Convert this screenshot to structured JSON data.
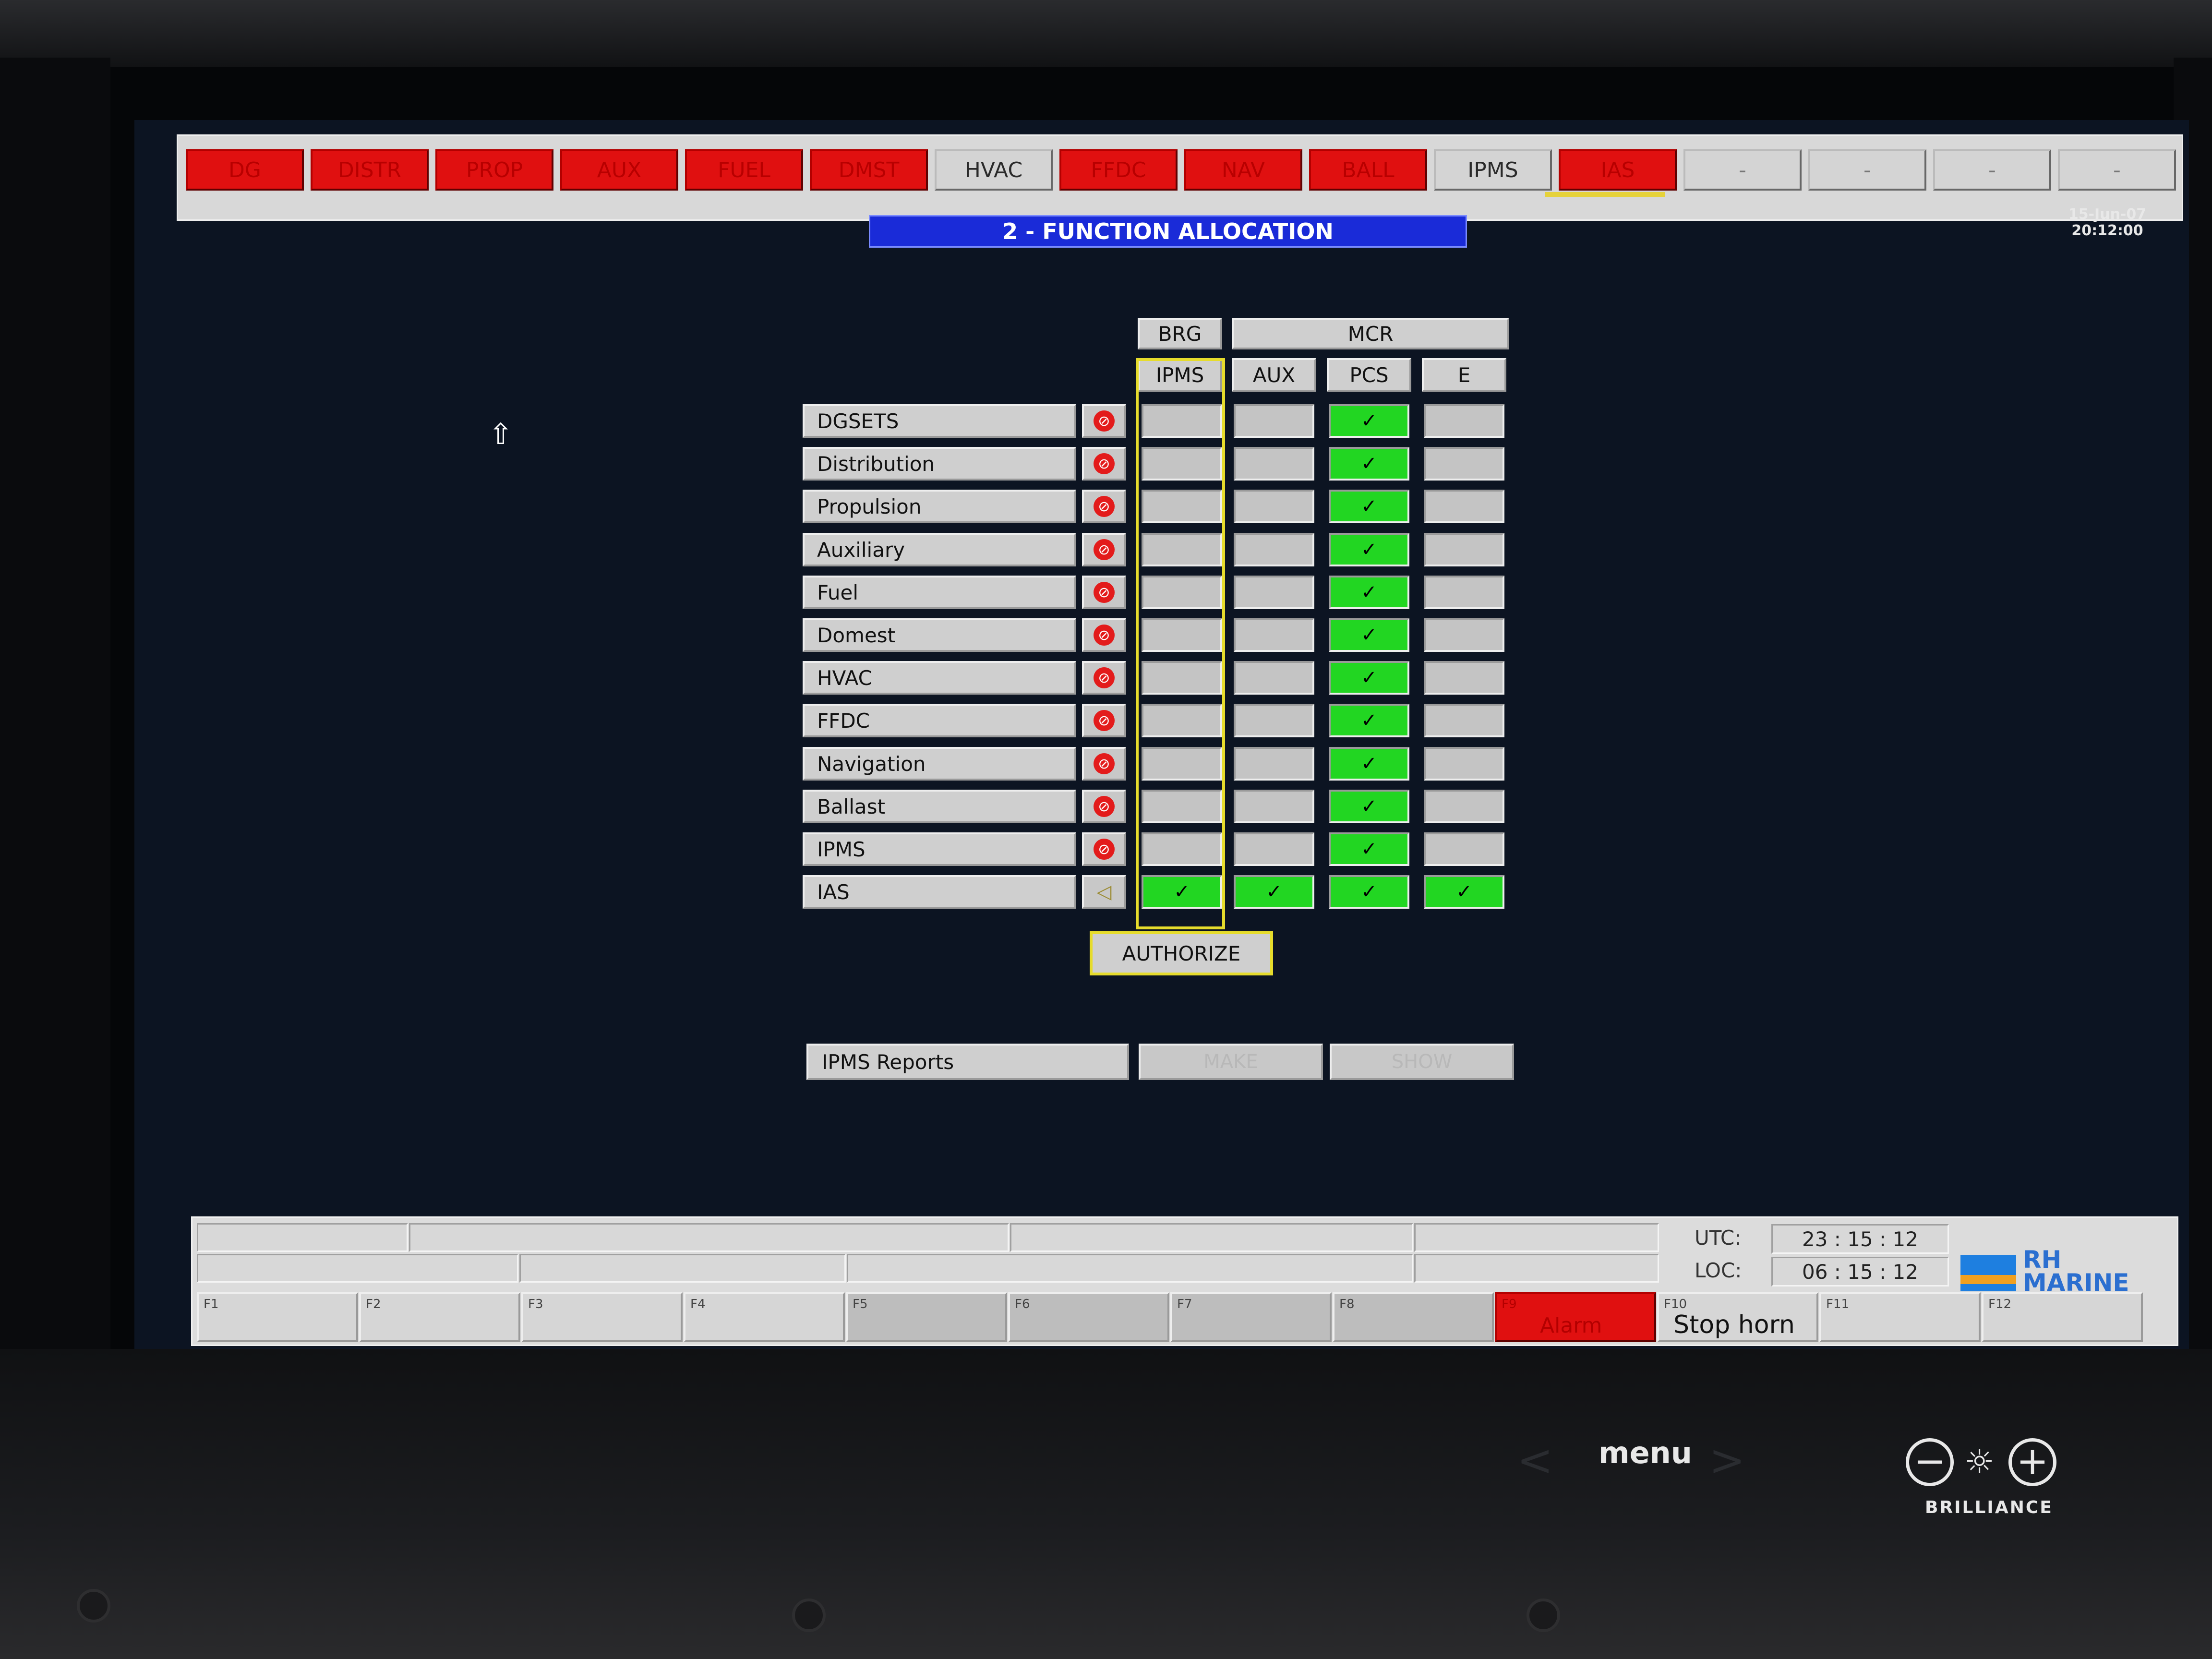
{
  "top_tabs": [
    {
      "label": "DG",
      "state": "alarm"
    },
    {
      "label": "DISTR",
      "state": "alarm"
    },
    {
      "label": "PROP",
      "state": "alarm"
    },
    {
      "label": "AUX",
      "state": "alarm"
    },
    {
      "label": "FUEL",
      "state": "alarm"
    },
    {
      "label": "DMST",
      "state": "alarm"
    },
    {
      "label": "HVAC",
      "state": "normal"
    },
    {
      "label": "FFDC",
      "state": "alarm"
    },
    {
      "label": "NAV",
      "state": "alarm"
    },
    {
      "label": "BALL",
      "state": "alarm"
    },
    {
      "label": "IPMS",
      "state": "normal"
    },
    {
      "label": "IAS",
      "state": "alarm"
    },
    {
      "label": "-",
      "state": "empty"
    },
    {
      "label": "-",
      "state": "empty"
    },
    {
      "label": "-",
      "state": "empty"
    },
    {
      "label": "-",
      "state": "empty"
    }
  ],
  "title": "2 - FUNCTION ALLOCATION",
  "date": "15-Jun-07",
  "time": "20:12:00",
  "headers": {
    "brg": "BRG",
    "mcr": "MCR",
    "columns": [
      "IPMS",
      "AUX",
      "PCS",
      "E"
    ]
  },
  "rows": [
    {
      "label": "DGSETS",
      "alarm": true,
      "cells": [
        false,
        false,
        true,
        false
      ]
    },
    {
      "label": "Distribution",
      "alarm": true,
      "cells": [
        false,
        false,
        true,
        false
      ]
    },
    {
      "label": "Propulsion",
      "alarm": true,
      "cells": [
        false,
        false,
        true,
        false
      ]
    },
    {
      "label": "Auxiliary",
      "alarm": true,
      "cells": [
        false,
        false,
        true,
        false
      ]
    },
    {
      "label": "Fuel",
      "alarm": true,
      "cells": [
        false,
        false,
        true,
        false
      ]
    },
    {
      "label": "Domest",
      "alarm": true,
      "cells": [
        false,
        false,
        true,
        false
      ]
    },
    {
      "label": "HVAC",
      "alarm": true,
      "cells": [
        false,
        false,
        true,
        false
      ]
    },
    {
      "label": "FFDC",
      "alarm": true,
      "cells": [
        false,
        false,
        true,
        false
      ]
    },
    {
      "label": "Navigation",
      "alarm": true,
      "cells": [
        false,
        false,
        true,
        false
      ]
    },
    {
      "label": "Ballast",
      "alarm": true,
      "cells": [
        false,
        false,
        true,
        false
      ]
    },
    {
      "label": "IPMS",
      "alarm": true,
      "cells": [
        false,
        false,
        true,
        false
      ]
    },
    {
      "label": "IAS",
      "alarm": false,
      "cells": [
        true,
        true,
        true,
        true
      ]
    }
  ],
  "checkmark": "✓",
  "authorize_label": "AUTHORIZE",
  "reports": {
    "label": "IPMS Reports",
    "make": "MAKE",
    "show": "SHOW"
  },
  "clock": {
    "utc_label": "UTC:",
    "utc_value": "23 : 15 : 12",
    "loc_label": "LOC:",
    "loc_value": "06 : 15 : 12"
  },
  "logo": {
    "line1": "RH",
    "line2": "MARINE"
  },
  "fkeys": [
    {
      "num": "F1",
      "label": "",
      "state": "normal"
    },
    {
      "num": "F2",
      "label": "",
      "state": "normal"
    },
    {
      "num": "F3",
      "label": "",
      "state": "normal"
    },
    {
      "num": "F4",
      "label": "",
      "state": "normal"
    },
    {
      "num": "F5",
      "label": "",
      "state": "dim"
    },
    {
      "num": "F6",
      "label": "",
      "state": "dim"
    },
    {
      "num": "F7",
      "label": "",
      "state": "dim"
    },
    {
      "num": "F8",
      "label": "",
      "state": "dim"
    },
    {
      "num": "F9",
      "label": "Alarm",
      "state": "alarm"
    },
    {
      "num": "F10",
      "label": "Stop horn",
      "state": "normal"
    },
    {
      "num": "F11",
      "label": "",
      "state": "normal"
    },
    {
      "num": "F12",
      "label": "",
      "state": "normal"
    }
  ],
  "hardware": {
    "menu_label": "menu",
    "brilliance_label": "BRILLIANCE",
    "minus": "−",
    "plus": "+",
    "sun": "☼",
    "prev": "<",
    "next": ">"
  },
  "colors": {
    "alarm_red": "#e01010",
    "active_green": "#22d622",
    "selection_yellow": "#e6dc2c",
    "title_blue": "#1a2bd8"
  }
}
